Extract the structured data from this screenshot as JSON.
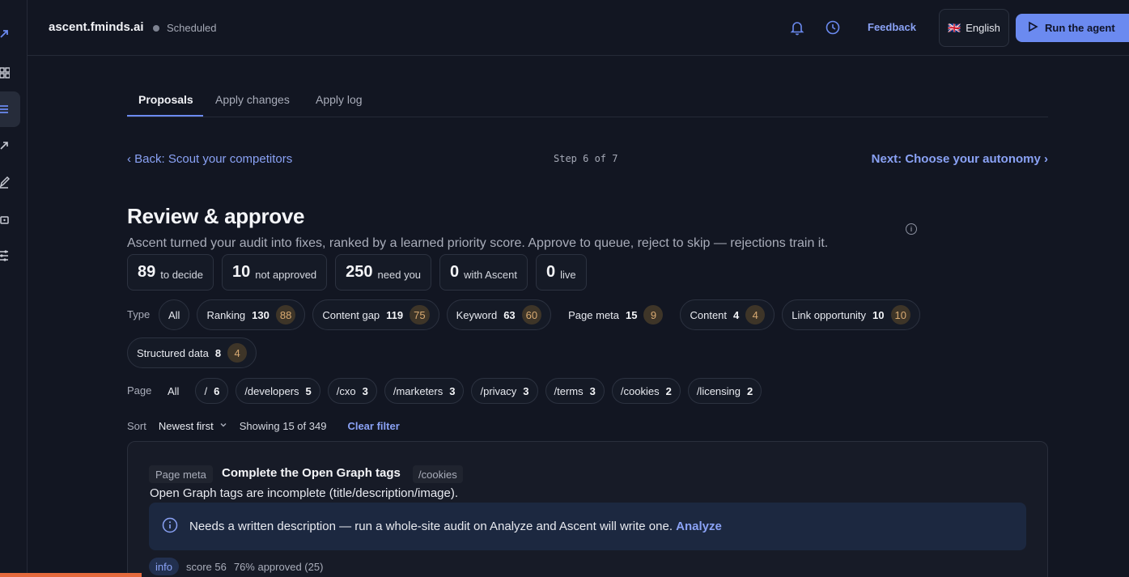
{
  "header": {
    "site": "ascent.fminds.ai",
    "status": "Scheduled",
    "feedback": "Feedback",
    "language": "English",
    "language_flag": "🇬🇧",
    "run_label": "Run the agent"
  },
  "rail": {
    "icons": [
      "arrow-up-right-icon",
      "grid-icon",
      "list-icon",
      "arrow-up-right-icon",
      "pen-icon",
      "plug-icon",
      "sliders-icon"
    ]
  },
  "tabs": [
    {
      "label": "Proposals",
      "active": true
    },
    {
      "label": "Apply changes",
      "active": false
    },
    {
      "label": "Apply log",
      "active": false
    }
  ],
  "nav": {
    "back": "‹ Back: Scout your competitors",
    "step": "Step 6 of 7",
    "next": "Next: Choose your autonomy ›"
  },
  "page": {
    "title": "Review & approve",
    "subtitle": "Ascent turned your audit into fixes, ranked by a learned priority score. Approve to queue, reject to skip — rejections train it.",
    "info_icon": "i"
  },
  "stats": [
    {
      "value": "89",
      "label": "to decide"
    },
    {
      "value": "10",
      "label": "not approved"
    },
    {
      "value": "250",
      "label": "need you"
    },
    {
      "value": "0",
      "label": "with Ascent"
    },
    {
      "value": "0",
      "label": "live"
    }
  ],
  "type_filter": {
    "label": "Type",
    "all": "All",
    "items": [
      {
        "label": "Ranking",
        "count": "130",
        "pending": "88"
      },
      {
        "label": "Content gap",
        "count": "119",
        "pending": "75"
      },
      {
        "label": "Keyword",
        "count": "63",
        "pending": "60"
      },
      {
        "label": "Page meta",
        "count": "15",
        "pending": "9"
      },
      {
        "label": "Content",
        "count": "4",
        "pending": "4"
      },
      {
        "label": "Link opportunity",
        "count": "10",
        "pending": "10"
      },
      {
        "label": "Structured data",
        "count": "8",
        "pending": "4"
      }
    ]
  },
  "page_filter": {
    "label": "Page",
    "all": "All",
    "items": [
      {
        "label": "/",
        "count": "6"
      },
      {
        "label": "/developers",
        "count": "5"
      },
      {
        "label": "/cxo",
        "count": "3"
      },
      {
        "label": "/marketers",
        "count": "3"
      },
      {
        "label": "/privacy",
        "count": "3"
      },
      {
        "label": "/terms",
        "count": "3"
      },
      {
        "label": "/cookies",
        "count": "2"
      },
      {
        "label": "/licensing",
        "count": "2"
      }
    ]
  },
  "sort": {
    "label": "Sort",
    "value": "Newest first",
    "showing": "Showing 15 of 349",
    "clear": "Clear filter"
  },
  "card": {
    "type": "Page meta",
    "title": "Complete the Open Graph tags",
    "path": "/cookies",
    "description": "Open Graph tags are incomplete (title/description/image).",
    "notice": "Needs a written description — run a whole-site audit on Analyze and Ascent will write one.",
    "notice_link": "Analyze",
    "severity": "info",
    "score": "score 56",
    "approved": "76% approved (25)"
  },
  "colors": {
    "accent": "#6b8af0",
    "background": "#121622",
    "badge": "#d8aa72",
    "progress": "#e4693d"
  }
}
